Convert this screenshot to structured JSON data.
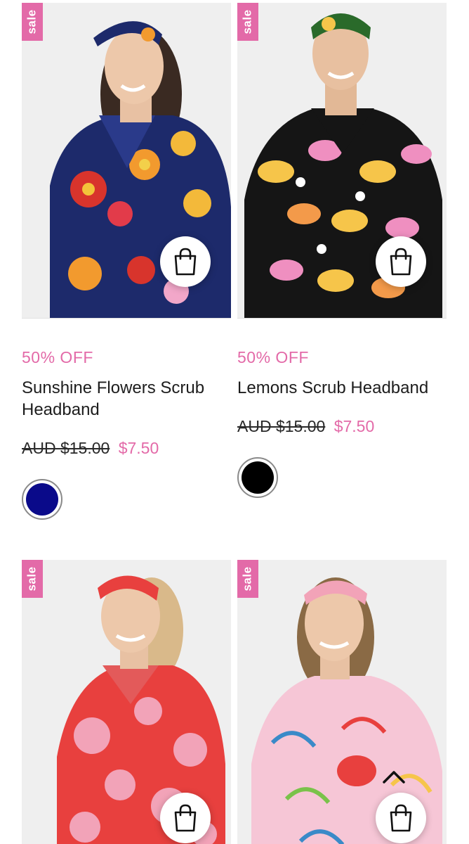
{
  "badge_label": "sale",
  "colors": {
    "accent": "#e36aa8",
    "text": "#1d1d1d"
  },
  "products": [
    {
      "discount": "50% OFF",
      "name": "Sunshine Flowers Scrub Headband",
      "price_old": "AUD $15.00",
      "price_new": "$7.50",
      "swatch_color": "#0a0a8a",
      "image": "model-navy-floral-scrubs"
    },
    {
      "discount": "50% OFF",
      "name": "Lemons Scrub Headband",
      "price_old": "AUD $15.00",
      "price_new": "$7.50",
      "swatch_color": "#000000",
      "image": "model-black-lemon-scrubs"
    },
    {
      "image": "model-red-pink-floral-scrubs"
    },
    {
      "image": "model-pink-abstract-scrubs"
    }
  ],
  "icons": {
    "cart": "shopping-bag-icon",
    "scroll_top": "chevron-up-icon"
  }
}
